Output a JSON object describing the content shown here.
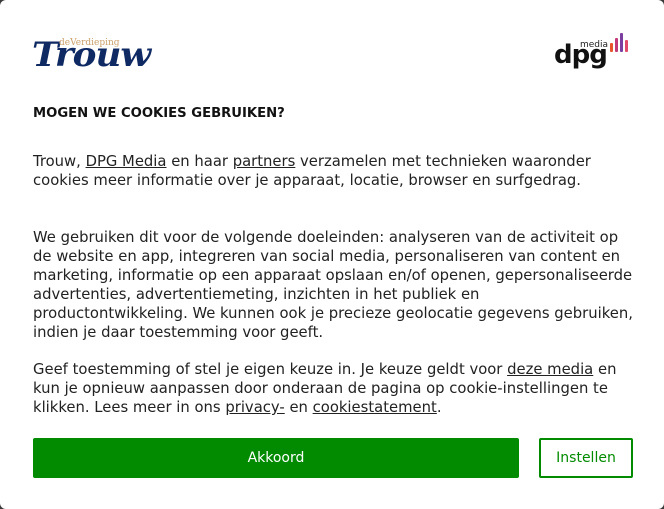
{
  "logos": {
    "brand_sub": "deVerdieping",
    "brand_name": "Trouw",
    "publisher_name": "dpg",
    "publisher_sub": "media",
    "publisher_bar_colors": [
      "#e8542b",
      "#c23a7a",
      "#7b3fa0",
      "#e24a6a"
    ]
  },
  "dialog": {
    "heading": "MOGEN WE COOKIES GEBRUIKEN?",
    "p1": {
      "t1": "Trouw, ",
      "link_dpg": "DPG Media",
      "t2": " en haar ",
      "link_partners": "partners",
      "t3": " verzamelen met technieken waaronder cookies meer informatie over je apparaat, locatie, browser en surfgedrag."
    },
    "p2": "We gebruiken dit voor de volgende doeleinden: analyseren van de activiteit op de website en app, integreren van social media, personaliseren van content en marketing, informatie op een apparaat opslaan en/of openen, gepersonaliseerde advertenties, advertentiemeting, inzichten in het publiek en productontwikkeling. We kunnen ook je precieze geolocatie gegevens gebruiken, indien je daar toestemming voor geeft.",
    "p3": {
      "t1": "Geef toestemming of stel je eigen keuze in. Je keuze geldt voor ",
      "link_media": "deze media",
      "t2": " en kun je opnieuw aanpassen door onderaan de pagina op cookie-instellingen te klikken. Lees meer in ons ",
      "link_privacy": "privacy-",
      "t3": " en ",
      "link_cookie": "cookiestatement",
      "t4": "."
    },
    "accept_label": "Akkoord",
    "settings_label": "Instellen",
    "accent_color": "#028b00"
  }
}
